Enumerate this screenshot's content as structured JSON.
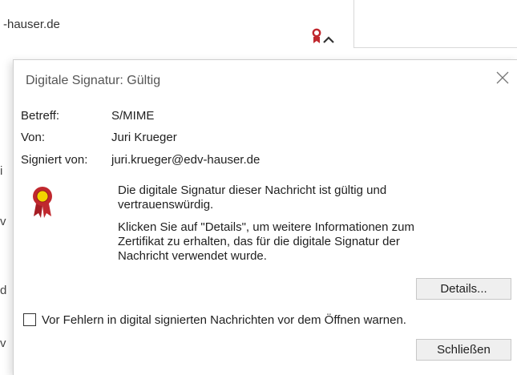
{
  "background": {
    "sender_fragment": "-hauser.de"
  },
  "dialog": {
    "title": "Digitale Signatur: Gültig",
    "fields": [
      {
        "label": "Betreff:",
        "value": "S/MIME"
      },
      {
        "label": "Von:",
        "value": "Juri Krueger"
      },
      {
        "label": "Signiert von:",
        "value": "juri.krueger@edv-hauser.de"
      }
    ],
    "message_valid_lines": [
      "Die digitale Signatur dieser Nachricht ist gültig und",
      "vertrauenswürdig."
    ],
    "message_info_lines": [
      "Klicken Sie auf \"Details\", um weitere Informationen zum",
      "Zertifikat zu erhalten, das für die digitale Signatur der",
      "Nachricht verwendet wurde."
    ],
    "details_button": "Details...",
    "warn_checkbox_label": "Vor Fehlern in digital signierten Nachrichten vor dem Öffnen warnen.",
    "warn_checkbox_checked": false,
    "close_button": "Schließen"
  },
  "icons": {
    "seal": "certificate-seal-icon",
    "signature_badge": "signature-badge-icon",
    "close": "close-icon",
    "chevron": "chevron-up-icon"
  },
  "colors": {
    "seal_red": "#c0282e",
    "seal_yellow": "#f2d300",
    "dialog_border": "#cfcfcf",
    "button_bg": "#efefef"
  }
}
